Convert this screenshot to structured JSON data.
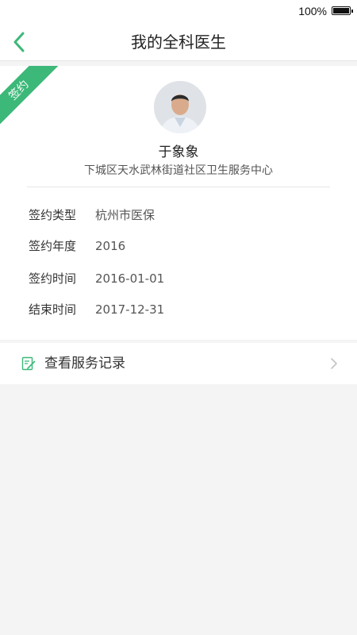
{
  "status_bar": {
    "battery_percent": "100%"
  },
  "header": {
    "title": "我的全科医生"
  },
  "signed_badge": "签约",
  "doctor": {
    "name": "于象象",
    "organization": "下城区天水武林街道社区卫生服务中心"
  },
  "contract": {
    "type": {
      "label": "签约类型",
      "value": "杭州市医保"
    },
    "year": {
      "label": "签约年度",
      "value": "2016"
    },
    "start": {
      "label": "签约时间",
      "value": "2016-01-01"
    },
    "end": {
      "label": "结束时间",
      "value": "2017-12-31"
    }
  },
  "service_record": {
    "label": "查看服务记录"
  },
  "colors": {
    "accent": "#3cb878",
    "background": "#f4f4f4"
  },
  "icons": [
    "back-arrow-icon",
    "battery-icon",
    "edit-record-icon",
    "chevron-right-icon"
  ]
}
